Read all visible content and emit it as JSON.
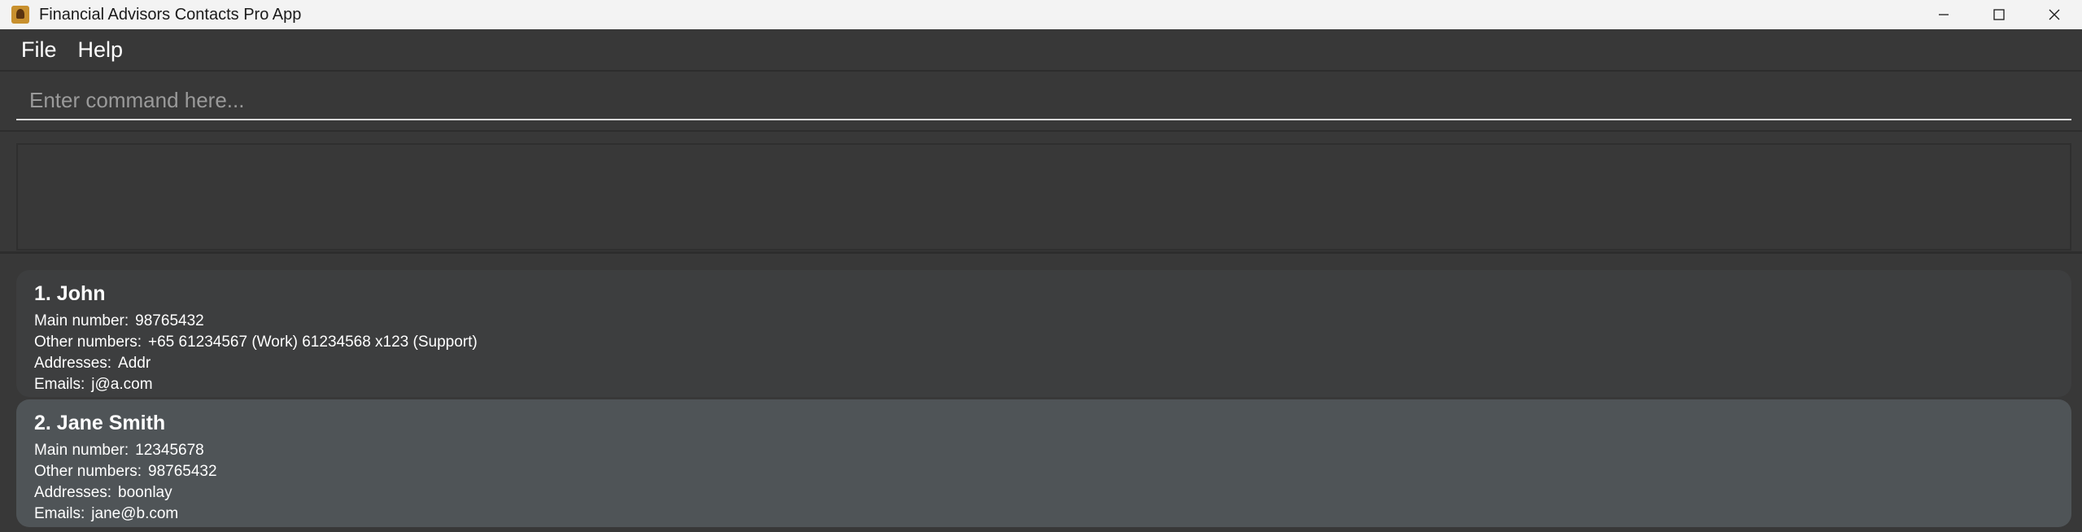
{
  "window": {
    "title": "Financial Advisors Contacts Pro App"
  },
  "menu": {
    "items": [
      {
        "label": "File"
      },
      {
        "label": "Help"
      }
    ]
  },
  "command": {
    "placeholder": "Enter command here...",
    "value": ""
  },
  "result": {
    "text": ""
  },
  "contacts": [
    {
      "title": "1. John",
      "main_label": "Main number:",
      "main": "98765432",
      "other_label": "Other numbers:",
      "other": "+65 61234567 (Work) 61234568 x123 (Support)",
      "addr_label": "Addresses:",
      "addr": "Addr",
      "email_label": "Emails:",
      "email": "j@a.com"
    },
    {
      "title": "2. Jane Smith",
      "main_label": "Main number:",
      "main": "12345678",
      "other_label": "Other numbers:",
      "other": "98765432",
      "addr_label": "Addresses:",
      "addr": "boonlay",
      "email_label": "Emails:",
      "email": "jane@b.com"
    }
  ],
  "icons": {
    "app": "app-icon",
    "minimize": "minimize-icon",
    "maximize": "maximize-icon",
    "close": "close-icon"
  }
}
